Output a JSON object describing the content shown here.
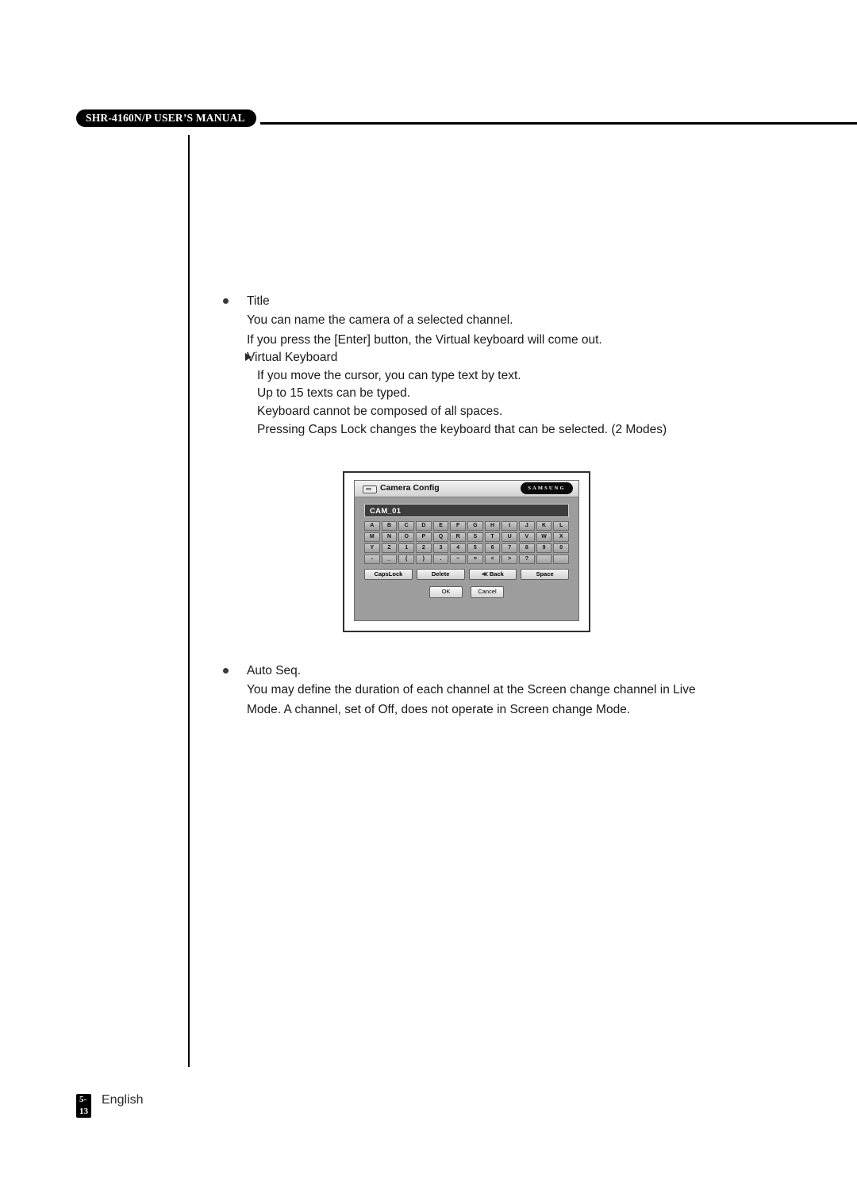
{
  "header": {
    "manual_title": "SHR-4160N/P USER’S MANUAL"
  },
  "sections": [
    {
      "bullet": "Title",
      "lines": [
        "You can name the camera of a selected channel.",
        "If you press the [Enter] button, the Virtual keyboard will come out."
      ],
      "sub_bullet": "Virtual Keyboard",
      "sub_lines": [
        "If you move the cursor, you can type text by text.",
        "Up to 15 texts can be typed.",
        "Keyboard cannot be composed of all spaces.",
        "Pressing Caps Lock changes the keyboard that can be selected. (2 Modes)"
      ]
    },
    {
      "bullet": "Auto Seq.",
      "lines": [
        "You may define the duration of each channel at the Screen change channel in Live",
        "Mode. A channel, set of Off, does not operate in Screen change Mode."
      ]
    }
  ],
  "dialog": {
    "title": "Camera Config",
    "brand": "SAMSUNG",
    "text_value": "CAM_01",
    "key_rows": [
      [
        "A",
        "B",
        "C",
        "D",
        "E",
        "F",
        "G",
        "H",
        "I",
        "J",
        "K",
        "L"
      ],
      [
        "M",
        "N",
        "O",
        "P",
        "Q",
        "R",
        "S",
        "T",
        "U",
        "V",
        "W",
        "X"
      ],
      [
        "Y",
        "Z",
        "1",
        "2",
        "3",
        "4",
        "5",
        "6",
        "7",
        "8",
        "9",
        "0"
      ],
      [
        "-",
        "_",
        "(",
        ")",
        ".",
        "~",
        "=",
        "<",
        ">",
        "?",
        " ",
        " "
      ]
    ],
    "func_keys": [
      "CapsLock",
      "Delete",
      "≪ Back",
      "Space"
    ],
    "ok_label": "OK",
    "cancel_label": "Cancel"
  },
  "footer": {
    "page_number": "5-13",
    "language": "English"
  }
}
